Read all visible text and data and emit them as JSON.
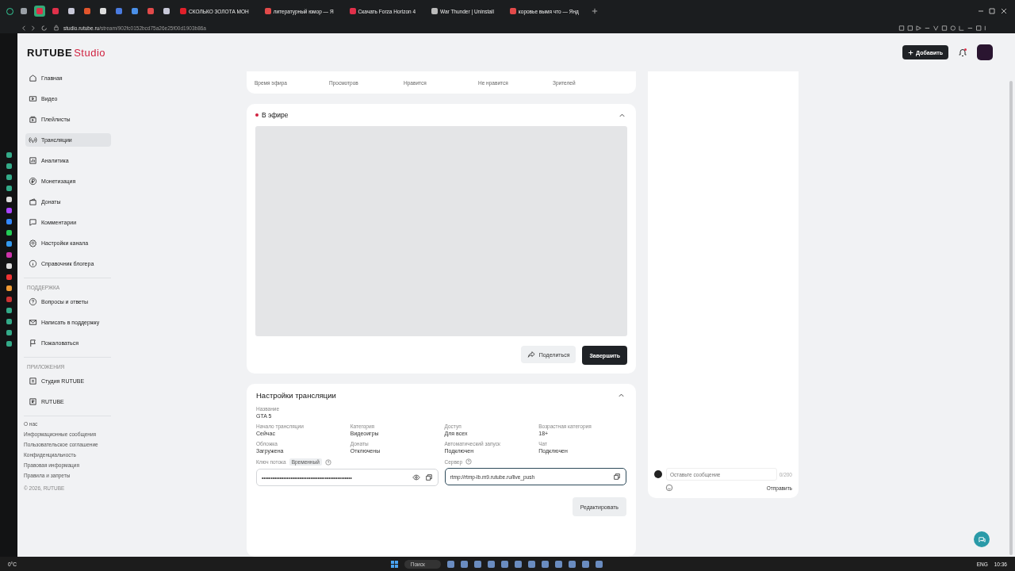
{
  "browser": {
    "pinned_tabs": [
      {
        "color": "#9aa0a6",
        "selected": false
      },
      {
        "color": "#e0304a",
        "selected": true
      },
      {
        "color": "#e0304a",
        "selected": false
      },
      {
        "color": "#c8c8d8",
        "selected": false
      },
      {
        "color": "#e2552c",
        "selected": false
      },
      {
        "color": "#dddddd",
        "selected": false
      },
      {
        "color": "#4a7be0",
        "selected": false
      },
      {
        "color": "#4a8fe8",
        "selected": false
      },
      {
        "color": "#e24a4a",
        "selected": false
      },
      {
        "color": "#c8c8d8",
        "selected": false
      }
    ],
    "tabs": [
      {
        "label": "СКОЛЬКО ЗОЛОТА МОН",
        "color": "#e0202a",
        "selected": false
      },
      {
        "label": "литературный юмор — Я",
        "color": "#e24a4a",
        "selected": false
      },
      {
        "label": "Скачать Forza Horizon 4",
        "color": "#e0304a",
        "selected": false
      },
      {
        "label": "War Thunder | Uninstall",
        "color": "#bbbbbb",
        "selected": false
      },
      {
        "label": "коровье вымя что — Янд",
        "color": "#e24a4a",
        "selected": false
      }
    ],
    "url_host": "studio.rutube.ru",
    "url_path": "/stream/902fc0152bcd75a26e25f00d1903b86a"
  },
  "header": {
    "logo": "RUTUBE",
    "logo_suffix": "Studio",
    "add_button": "Добавить",
    "notification": true
  },
  "sidebar": {
    "items": [
      {
        "label": "Главная",
        "selected": false
      },
      {
        "label": "Видео",
        "selected": false
      },
      {
        "label": "Плейлисты",
        "selected": false
      },
      {
        "label": "Трансляции",
        "selected": true
      },
      {
        "label": "Аналитика",
        "selected": false
      },
      {
        "label": "Монетизация",
        "selected": false
      },
      {
        "label": "Донаты",
        "selected": false
      },
      {
        "label": "Комментарии",
        "selected": false
      },
      {
        "label": "Настройки канала",
        "selected": false
      },
      {
        "label": "Справочник блогера",
        "selected": false
      }
    ],
    "support_title": "ПОДДЕРЖКА",
    "support_items": [
      "Вопросы и ответы",
      "Написать в поддержку",
      "Пожаловаться"
    ],
    "apps_title": "ПРИЛОЖЕНИЯ",
    "apps": [
      "Студия RUTUBE",
      "RUTUBE"
    ],
    "footer_links": [
      "О нас",
      "Информационные сообщения",
      "Пользовательское соглашение",
      "Конфиденциальность",
      "Правовая информация",
      "Правила и запреты"
    ],
    "copyright": "© 2026, RUTUBE"
  },
  "stats": {
    "labels": [
      "Время эфира",
      "Просмотров",
      "Нравится",
      "Не нравится",
      "Зрителей"
    ]
  },
  "live": {
    "status": "В эфире",
    "on_air": true,
    "expanded": true,
    "share": "Поделиться",
    "finish": "Завершить"
  },
  "settings": {
    "title": "Настройки трансляции",
    "expanded": true,
    "name": {
      "label": "Название",
      "value": "GTA 5"
    },
    "fields": [
      {
        "label": "Начало трансляции",
        "value": "Сейчас"
      },
      {
        "label": "Категория",
        "value": "Видеоигры"
      },
      {
        "label": "Доступ",
        "value": "Для всех"
      },
      {
        "label": "Возрастная категория",
        "value": "18+"
      },
      {
        "label": "Обложка",
        "value": "Загружена"
      },
      {
        "label": "Донаты",
        "value": "Отключены"
      },
      {
        "label": "Автоматический запуск",
        "value": "Подключен"
      },
      {
        "label": "Чат",
        "value": "Подключен"
      }
    ],
    "stream_key": {
      "label": "Ключ потока",
      "badge": "Временный",
      "value": "••••••••••••••••••••••••••••••••••••••••••••••••••"
    },
    "server": {
      "label": "Сервер",
      "value": "rtmp://rtmp-lb.m9.rutube.ru/live_push",
      "focused": true
    },
    "edit": "Редактировать"
  },
  "chat": {
    "placeholder": "Оставьте сообщение",
    "counter": "0/200",
    "send": "Отправить"
  },
  "taskbar": {
    "weather": "0°C",
    "search": "Поиск",
    "lang": "ENG",
    "time": "10:36"
  }
}
